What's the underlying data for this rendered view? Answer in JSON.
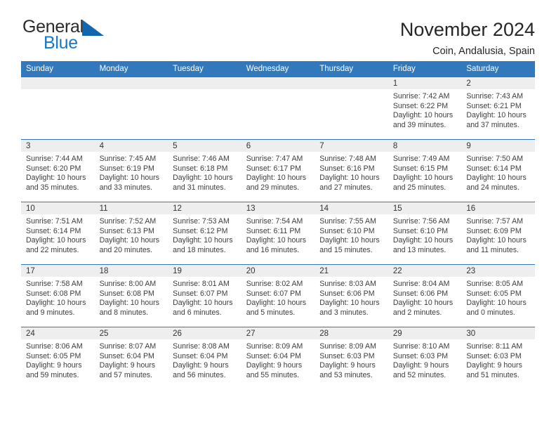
{
  "brand": {
    "name_part1": "General",
    "name_part2": "Blue",
    "triangle_color": "#1266ae",
    "blue_color": "#1878c8"
  },
  "header": {
    "title": "November 2024",
    "subtitle": "Coin, Andalusia, Spain"
  },
  "theme": {
    "header_bg": "#3179bc",
    "daynum_bg": "#eeeeee",
    "text": "#3d3d3d"
  },
  "weekday_headers": [
    "Sunday",
    "Monday",
    "Tuesday",
    "Wednesday",
    "Thursday",
    "Friday",
    "Saturday"
  ],
  "weeks": [
    [
      {
        "day": "",
        "sunrise": "",
        "sunset": "",
        "daylight_line1": "",
        "daylight_line2": ""
      },
      {
        "day": "",
        "sunrise": "",
        "sunset": "",
        "daylight_line1": "",
        "daylight_line2": ""
      },
      {
        "day": "",
        "sunrise": "",
        "sunset": "",
        "daylight_line1": "",
        "daylight_line2": ""
      },
      {
        "day": "",
        "sunrise": "",
        "sunset": "",
        "daylight_line1": "",
        "daylight_line2": ""
      },
      {
        "day": "",
        "sunrise": "",
        "sunset": "",
        "daylight_line1": "",
        "daylight_line2": ""
      },
      {
        "day": "1",
        "sunrise": "Sunrise: 7:42 AM",
        "sunset": "Sunset: 6:22 PM",
        "daylight_line1": "Daylight: 10 hours",
        "daylight_line2": "and 39 minutes."
      },
      {
        "day": "2",
        "sunrise": "Sunrise: 7:43 AM",
        "sunset": "Sunset: 6:21 PM",
        "daylight_line1": "Daylight: 10 hours",
        "daylight_line2": "and 37 minutes."
      }
    ],
    [
      {
        "day": "3",
        "sunrise": "Sunrise: 7:44 AM",
        "sunset": "Sunset: 6:20 PM",
        "daylight_line1": "Daylight: 10 hours",
        "daylight_line2": "and 35 minutes."
      },
      {
        "day": "4",
        "sunrise": "Sunrise: 7:45 AM",
        "sunset": "Sunset: 6:19 PM",
        "daylight_line1": "Daylight: 10 hours",
        "daylight_line2": "and 33 minutes."
      },
      {
        "day": "5",
        "sunrise": "Sunrise: 7:46 AM",
        "sunset": "Sunset: 6:18 PM",
        "daylight_line1": "Daylight: 10 hours",
        "daylight_line2": "and 31 minutes."
      },
      {
        "day": "6",
        "sunrise": "Sunrise: 7:47 AM",
        "sunset": "Sunset: 6:17 PM",
        "daylight_line1": "Daylight: 10 hours",
        "daylight_line2": "and 29 minutes."
      },
      {
        "day": "7",
        "sunrise": "Sunrise: 7:48 AM",
        "sunset": "Sunset: 6:16 PM",
        "daylight_line1": "Daylight: 10 hours",
        "daylight_line2": "and 27 minutes."
      },
      {
        "day": "8",
        "sunrise": "Sunrise: 7:49 AM",
        "sunset": "Sunset: 6:15 PM",
        "daylight_line1": "Daylight: 10 hours",
        "daylight_line2": "and 25 minutes."
      },
      {
        "day": "9",
        "sunrise": "Sunrise: 7:50 AM",
        "sunset": "Sunset: 6:14 PM",
        "daylight_line1": "Daylight: 10 hours",
        "daylight_line2": "and 24 minutes."
      }
    ],
    [
      {
        "day": "10",
        "sunrise": "Sunrise: 7:51 AM",
        "sunset": "Sunset: 6:14 PM",
        "daylight_line1": "Daylight: 10 hours",
        "daylight_line2": "and 22 minutes."
      },
      {
        "day": "11",
        "sunrise": "Sunrise: 7:52 AM",
        "sunset": "Sunset: 6:13 PM",
        "daylight_line1": "Daylight: 10 hours",
        "daylight_line2": "and 20 minutes."
      },
      {
        "day": "12",
        "sunrise": "Sunrise: 7:53 AM",
        "sunset": "Sunset: 6:12 PM",
        "daylight_line1": "Daylight: 10 hours",
        "daylight_line2": "and 18 minutes."
      },
      {
        "day": "13",
        "sunrise": "Sunrise: 7:54 AM",
        "sunset": "Sunset: 6:11 PM",
        "daylight_line1": "Daylight: 10 hours",
        "daylight_line2": "and 16 minutes."
      },
      {
        "day": "14",
        "sunrise": "Sunrise: 7:55 AM",
        "sunset": "Sunset: 6:10 PM",
        "daylight_line1": "Daylight: 10 hours",
        "daylight_line2": "and 15 minutes."
      },
      {
        "day": "15",
        "sunrise": "Sunrise: 7:56 AM",
        "sunset": "Sunset: 6:10 PM",
        "daylight_line1": "Daylight: 10 hours",
        "daylight_line2": "and 13 minutes."
      },
      {
        "day": "16",
        "sunrise": "Sunrise: 7:57 AM",
        "sunset": "Sunset: 6:09 PM",
        "daylight_line1": "Daylight: 10 hours",
        "daylight_line2": "and 11 minutes."
      }
    ],
    [
      {
        "day": "17",
        "sunrise": "Sunrise: 7:58 AM",
        "sunset": "Sunset: 6:08 PM",
        "daylight_line1": "Daylight: 10 hours",
        "daylight_line2": "and 9 minutes."
      },
      {
        "day": "18",
        "sunrise": "Sunrise: 8:00 AM",
        "sunset": "Sunset: 6:08 PM",
        "daylight_line1": "Daylight: 10 hours",
        "daylight_line2": "and 8 minutes."
      },
      {
        "day": "19",
        "sunrise": "Sunrise: 8:01 AM",
        "sunset": "Sunset: 6:07 PM",
        "daylight_line1": "Daylight: 10 hours",
        "daylight_line2": "and 6 minutes."
      },
      {
        "day": "20",
        "sunrise": "Sunrise: 8:02 AM",
        "sunset": "Sunset: 6:07 PM",
        "daylight_line1": "Daylight: 10 hours",
        "daylight_line2": "and 5 minutes."
      },
      {
        "day": "21",
        "sunrise": "Sunrise: 8:03 AM",
        "sunset": "Sunset: 6:06 PM",
        "daylight_line1": "Daylight: 10 hours",
        "daylight_line2": "and 3 minutes."
      },
      {
        "day": "22",
        "sunrise": "Sunrise: 8:04 AM",
        "sunset": "Sunset: 6:06 PM",
        "daylight_line1": "Daylight: 10 hours",
        "daylight_line2": "and 2 minutes."
      },
      {
        "day": "23",
        "sunrise": "Sunrise: 8:05 AM",
        "sunset": "Sunset: 6:05 PM",
        "daylight_line1": "Daylight: 10 hours",
        "daylight_line2": "and 0 minutes."
      }
    ],
    [
      {
        "day": "24",
        "sunrise": "Sunrise: 8:06 AM",
        "sunset": "Sunset: 6:05 PM",
        "daylight_line1": "Daylight: 9 hours",
        "daylight_line2": "and 59 minutes."
      },
      {
        "day": "25",
        "sunrise": "Sunrise: 8:07 AM",
        "sunset": "Sunset: 6:04 PM",
        "daylight_line1": "Daylight: 9 hours",
        "daylight_line2": "and 57 minutes."
      },
      {
        "day": "26",
        "sunrise": "Sunrise: 8:08 AM",
        "sunset": "Sunset: 6:04 PM",
        "daylight_line1": "Daylight: 9 hours",
        "daylight_line2": "and 56 minutes."
      },
      {
        "day": "27",
        "sunrise": "Sunrise: 8:09 AM",
        "sunset": "Sunset: 6:04 PM",
        "daylight_line1": "Daylight: 9 hours",
        "daylight_line2": "and 55 minutes."
      },
      {
        "day": "28",
        "sunrise": "Sunrise: 8:09 AM",
        "sunset": "Sunset: 6:03 PM",
        "daylight_line1": "Daylight: 9 hours",
        "daylight_line2": "and 53 minutes."
      },
      {
        "day": "29",
        "sunrise": "Sunrise: 8:10 AM",
        "sunset": "Sunset: 6:03 PM",
        "daylight_line1": "Daylight: 9 hours",
        "daylight_line2": "and 52 minutes."
      },
      {
        "day": "30",
        "sunrise": "Sunrise: 8:11 AM",
        "sunset": "Sunset: 6:03 PM",
        "daylight_line1": "Daylight: 9 hours",
        "daylight_line2": "and 51 minutes."
      }
    ]
  ]
}
